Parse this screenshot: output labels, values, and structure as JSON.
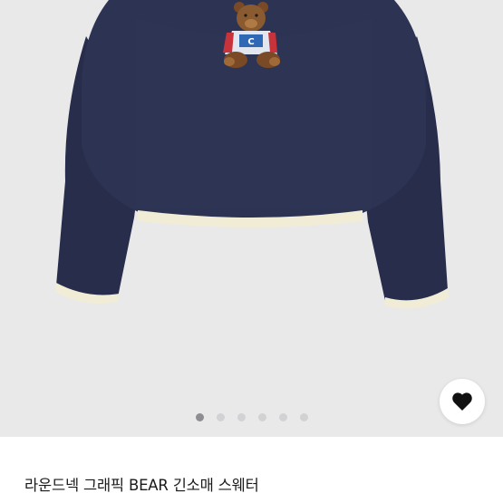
{
  "product": {
    "title": "라운드넥 그래픽 BEAR 긴소매 스웨터",
    "graphic_letter": "C"
  },
  "gallery": {
    "image_count": 6,
    "active_index": 0
  },
  "icons": {
    "like": "heart-icon"
  },
  "colors": {
    "image_background": "#e9e9ea",
    "sweater": "#2b3150",
    "trim": "#f1ecd6",
    "dot_active": "#8e8e92",
    "dot_inactive": "#d2d2d4",
    "title_text": "#1a1a1a"
  }
}
